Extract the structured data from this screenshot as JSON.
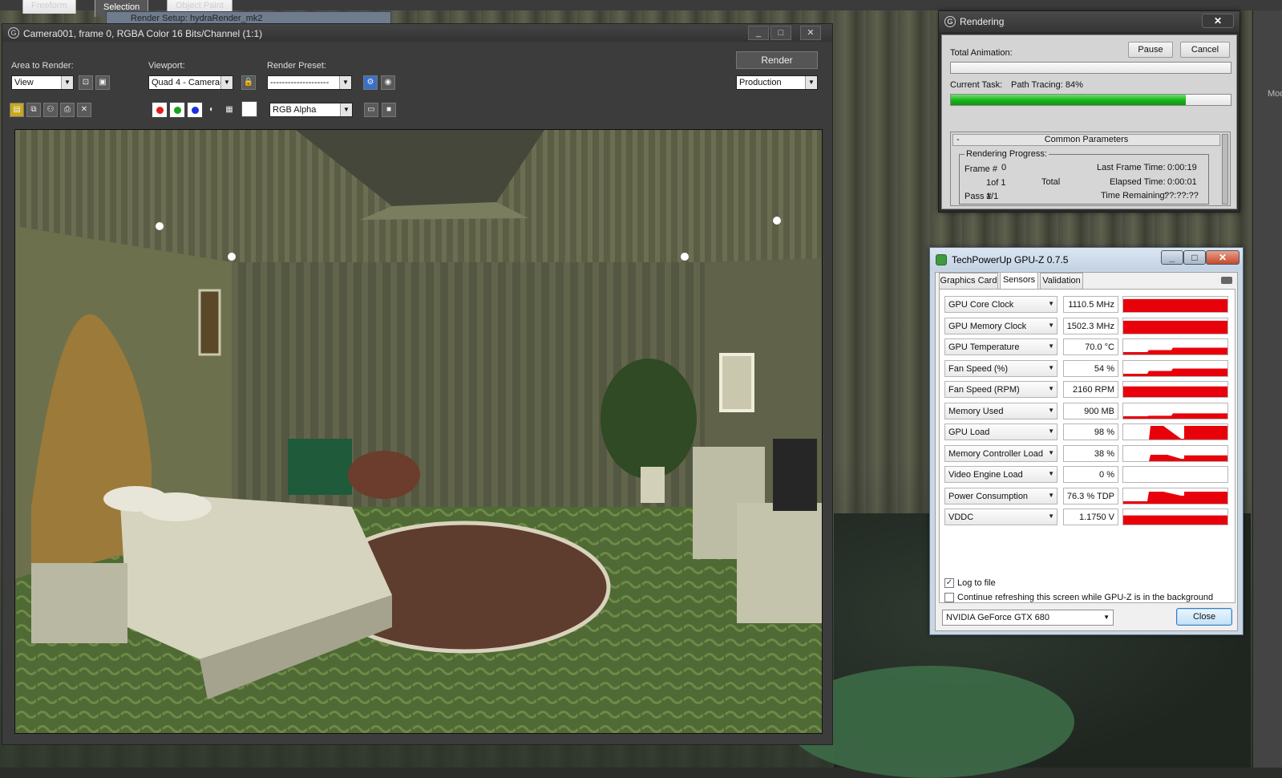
{
  "workspace": {
    "ribbon_tabs": [
      "Freeform",
      "Selection",
      "Object Paint"
    ],
    "ribbon_active": "Selection",
    "background_window_title": "Render Setup: hydraRender_mk2",
    "right_strip_label": "Modi"
  },
  "frame_buffer": {
    "title": "Camera001, frame 0, RGBA Color 16 Bits/Channel (1:1)",
    "area_label": "Area to Render:",
    "area_value": "View",
    "viewport_label": "Viewport:",
    "viewport_value": "Quad 4 - Camera(",
    "preset_label": "Render Preset:",
    "preset_value": "--------------------",
    "render_button": "Render",
    "production_value": "Production",
    "channel_value": "RGB Alpha",
    "channel_colors": [
      "#e21b1b",
      "#1aa21a",
      "#1b2fe0"
    ]
  },
  "rendering": {
    "title": "Rendering",
    "pause": "Pause",
    "cancel": "Cancel",
    "total_label": "Total Animation:",
    "total_progress": 0,
    "current_label": "Current Task:",
    "current_task": "Path Tracing: 84%",
    "current_progress": 0.84,
    "common_header": "Common Parameters",
    "collapse_symbol": "-",
    "progress_group": "Rendering Progress:",
    "frame_label": "Frame #",
    "frame_value": "0",
    "of_value": "1of 1",
    "total_word": "Total",
    "pass_label": "Pass #",
    "pass_value": "1/1",
    "last_frame_label": "Last Frame Time:",
    "last_frame_value": "0:00:19",
    "elapsed_label": "Elapsed Time:",
    "elapsed_value": "0:00:01",
    "remaining_label": "Time Remaining:",
    "remaining_value": "??:??:??"
  },
  "gpuz": {
    "title": "TechPowerUp GPU-Z 0.7.5",
    "tabs": [
      "Graphics Card",
      "Sensors",
      "Validation"
    ],
    "active_tab": "Sensors",
    "sensors": [
      {
        "name": "GPU Core Clock",
        "value": "1110.5 MHz",
        "level": 0.85,
        "shape": "flat"
      },
      {
        "name": "GPU Memory Clock",
        "value": "1502.3 MHz",
        "level": 0.85,
        "shape": "flat"
      },
      {
        "name": "GPU Temperature",
        "value": "70.0 °C",
        "level": 0.45,
        "shape": "temp"
      },
      {
        "name": "Fan Speed (%)",
        "value": "54 %",
        "level": 0.5,
        "shape": "temp"
      },
      {
        "name": "Fan Speed (RPM)",
        "value": "2160 RPM",
        "level": 0.7,
        "shape": "flat"
      },
      {
        "name": "Memory Used",
        "value": "900 MB",
        "level": 0.35,
        "shape": "temp"
      },
      {
        "name": "GPU Load",
        "value": "98 %",
        "level": 0.98,
        "shape": "load"
      },
      {
        "name": "Memory Controller Load",
        "value": "38 %",
        "level": 0.38,
        "shape": "mem"
      },
      {
        "name": "Video Engine Load",
        "value": "0 %",
        "level": 0.0,
        "shape": "none"
      },
      {
        "name": "Power Consumption",
        "value": "76.3 % TDP",
        "level": 0.76,
        "shape": "power"
      },
      {
        "name": "VDDC",
        "value": "1.1750 V",
        "level": 0.6,
        "shape": "flat"
      }
    ],
    "log_to_file": "Log to file",
    "continue_refresh": "Continue refreshing this screen while GPU-Z is in the background",
    "gpu_name": "NVIDIA GeForce GTX 680",
    "close": "Close",
    "graph_color": "#e8000b"
  }
}
